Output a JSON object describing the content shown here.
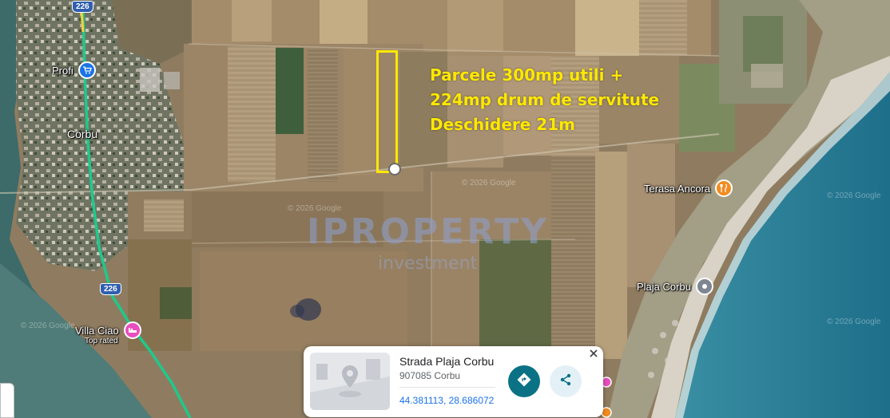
{
  "annotation": {
    "line1": "Parcele 300mp utili +",
    "line2": "224mp drum de servitute",
    "line3": "Deschidere 21m"
  },
  "places": {
    "profi": "Profi",
    "corbu_town": "Corbu",
    "terasa_ancora": "Terasa Ancora",
    "plaja_corbu": "Plaja Corbu",
    "villa_ciao": "Villa Ciao",
    "villa_ciao_badge": "Top rated"
  },
  "roads": {
    "shield_top": "226",
    "shield_mid": "226"
  },
  "watermark": {
    "brand": "IPROPERTY",
    "sub": "investment"
  },
  "map_copyright": "© 2026 Google",
  "card": {
    "title": "Strada Plaja Corbu",
    "subtitle": "907085 Corbu",
    "coordinates": "44.381113, 28.686072"
  },
  "icons": {
    "directions": "directions-icon",
    "share": "share-icon",
    "close": "close-icon",
    "shopping": "shopping-cart-icon",
    "restaurant": "restaurant-icon",
    "beach": "place-icon",
    "hotel": "hotel-icon"
  },
  "colors": {
    "annotation": "#ffe800",
    "directions_button": "#0b7285",
    "coords_link": "#1a73e8",
    "route": "#21c98a"
  }
}
